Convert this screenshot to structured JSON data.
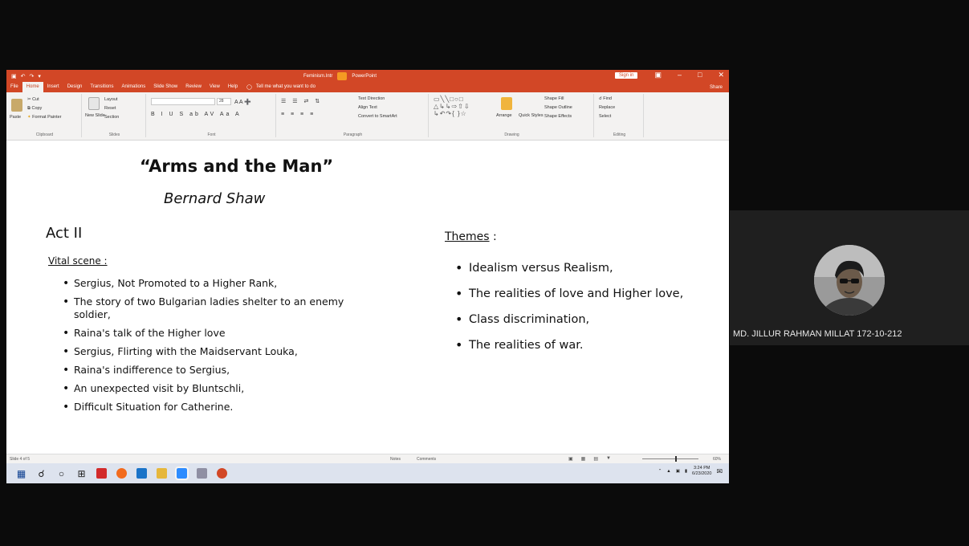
{
  "powerpoint": {
    "title": "Feminism.Intr",
    "app": "PowerPoint",
    "sign_in": "Sign in",
    "tabs": [
      "File",
      "Home",
      "Insert",
      "Design",
      "Transitions",
      "Animations",
      "Slide Show",
      "Review",
      "View",
      "Help"
    ],
    "tell_me": "Tell me what you want to do",
    "share": "Share",
    "ribbon": {
      "clipboard": {
        "paste": "Paste",
        "cut": "Cut",
        "copy": "Copy",
        "format_painter": "Format Painter",
        "name": "Clipboard"
      },
      "slides": {
        "new_slide": "New Slide",
        "layout": "Layout",
        "reset": "Reset",
        "section": "Section",
        "name": "Slides"
      },
      "font": {
        "size": "28",
        "name": "Font"
      },
      "paragraph": {
        "text_direction": "Text Direction",
        "align_text": "Align Text",
        "convert_smartart": "Convert to SmartArt",
        "name": "Paragraph"
      },
      "drawing": {
        "arrange": "Arrange",
        "quick_styles": "Quick Styles",
        "shape_fill": "Shape Fill",
        "shape_outline": "Shape Outline",
        "shape_effects": "Shape Effects",
        "name": "Drawing"
      },
      "editing": {
        "find": "Find",
        "replace": "Replace",
        "select": "Select",
        "name": "Editing"
      }
    },
    "slide": {
      "title": "“Arms and the Man”",
      "author": "Bernard Shaw",
      "act": "Act II",
      "vital_heading": "Vital scene :",
      "vital_items": [
        "Sergius, Not Promoted to a Higher Rank,",
        "The story of two Bulgarian ladies shelter to an enemy soldier,",
        "Raina's talk of the Higher love",
        "Sergius, Flirting with the Maidservant Louka,",
        "Raina's indifference to Sergius,",
        "An unexpected visit by Bluntschli,",
        "Difficult Situation for Catherine."
      ],
      "themes_heading": "Themes",
      "themes_colon": " :",
      "themes": [
        "Idealism versus Realism,",
        "The realities of love and Higher love,",
        "Class discrimination,",
        "The realities of war."
      ]
    },
    "status": {
      "slide_counter": "Slide 4 of 5",
      "notes": "Notes",
      "comments": "Comments",
      "zoom_value": "60%",
      "zoom_level": 0.6
    }
  },
  "taskbar": {
    "time": "3:24 PM",
    "date": "6/23/2020"
  },
  "participant": {
    "name": "MD. JILLUR RAHMAN MILLAT 172-10-212"
  },
  "colors": {
    "ppt_accent": "#d24726",
    "ribbon_bg": "#f3f2f1",
    "taskbar_bg": "#dde3ee",
    "background": "#0b0b0b",
    "tile_bg": "#1f1f1f"
  },
  "icons": [
    "save-icon",
    "undo-icon",
    "redo-icon",
    "paste-icon",
    "cut-icon",
    "copy-icon",
    "format-painter-icon",
    "new-slide-icon",
    "search-icon",
    "windows-start-icon",
    "task-view-icon",
    "cortana-icon",
    "acrobat-icon",
    "browser-icon",
    "mail-icon",
    "file-explorer-icon",
    "zoom-app-icon",
    "powerpoint-taskbar-icon",
    "notification-icon",
    "lightbulb-icon"
  ]
}
